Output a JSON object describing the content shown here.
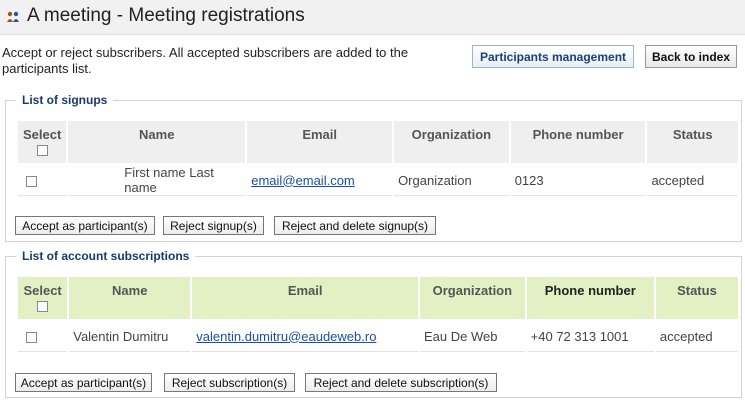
{
  "header": {
    "title": "A meeting - Meeting registrations",
    "icon": "people-icon"
  },
  "intro_text": "Accept or reject subscribers. All accepted subscribers are added to the participants list.",
  "buttons": {
    "participants_management": "Participants management",
    "back_to_index": "Back to index"
  },
  "signups": {
    "legend": "List of signups",
    "columns": [
      "Select",
      "Name",
      "Email",
      "Organization",
      "Phone number",
      "Status"
    ],
    "rows": [
      {
        "name": "First name Last name",
        "email": "email@email.com",
        "organization": "Organization",
        "phone": "0123",
        "status": "accepted"
      }
    ],
    "actions": [
      "Accept as participant(s)",
      "Reject signup(s)",
      "Reject and delete signup(s)"
    ]
  },
  "subscriptions": {
    "legend": "List of account subscriptions",
    "columns": [
      "Select",
      "Name",
      "Email",
      "Organization",
      "Phone number",
      "Status"
    ],
    "rows": [
      {
        "name": "Valentin Dumitru",
        "email": "valentin.dumitru@eaudeweb.ro",
        "organization": "Eau De Web",
        "phone": "+40 72 313 1001",
        "status": "accepted"
      }
    ],
    "actions": [
      "Accept as participant(s)",
      "Reject subscription(s)",
      "Reject and delete subscription(s)"
    ]
  },
  "colors": {
    "header_bg": "#f1f1f1",
    "legend_text": "#1a3a6a",
    "table1_header": "#efefef",
    "table2_header": "#e2f0c4",
    "link": "#1a4fa0"
  }
}
